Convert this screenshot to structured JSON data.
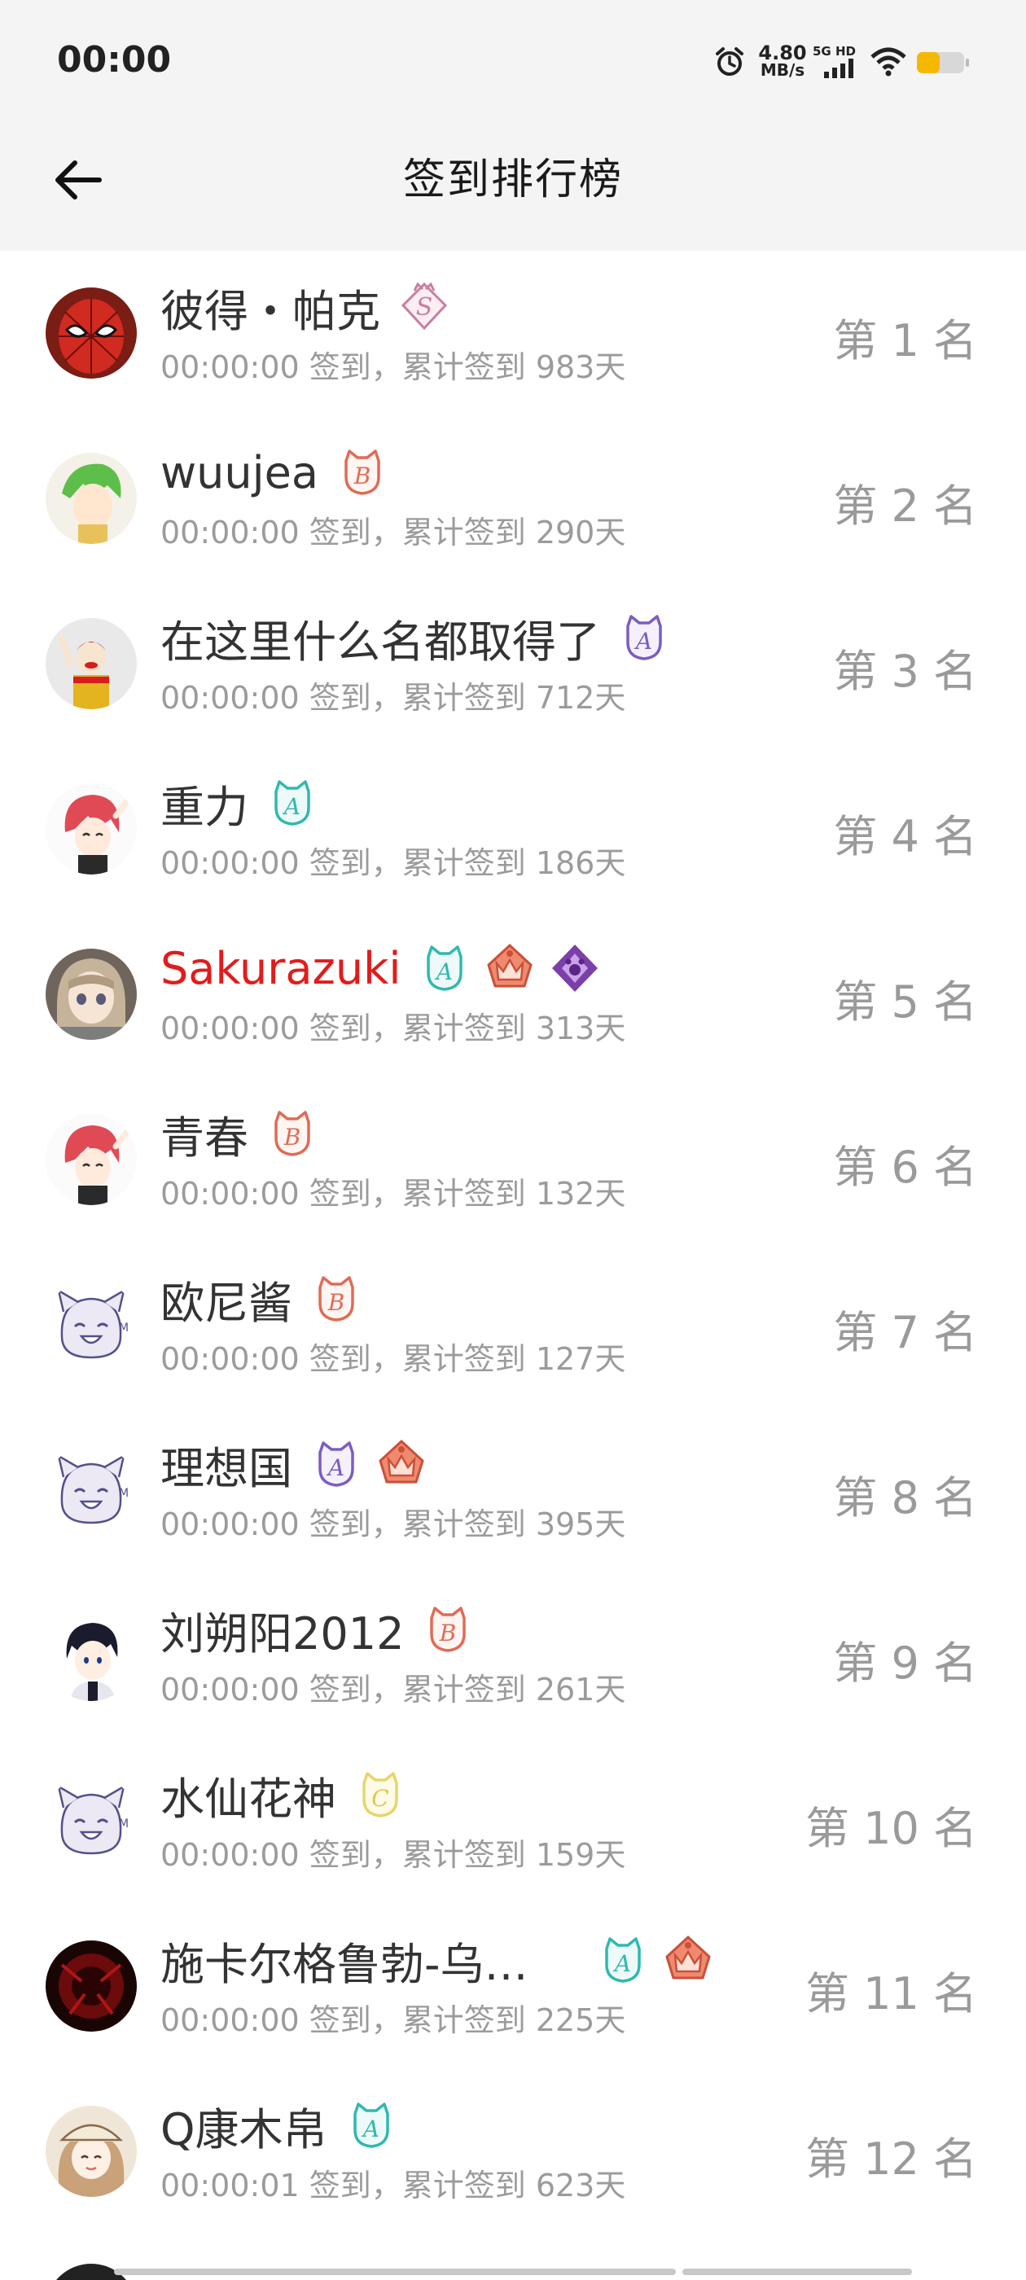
{
  "status_bar": {
    "time": "00:00",
    "net_speed_value": "4.80",
    "net_speed_unit": "MB/s",
    "signal_label": "5G HD",
    "icons": [
      "alarm-icon",
      "signal-icon",
      "wifi-icon",
      "battery-icon"
    ],
    "battery_color": "#f5b800"
  },
  "header": {
    "title": "签到排行榜",
    "back_icon": "arrow-left-icon"
  },
  "rows": [
    {
      "name": "彼得・帕克",
      "sub": "00:00:00 签到，累计签到 983天",
      "rank": "第 1 名",
      "badges": [
        "badge-s"
      ],
      "avatar": "spiderman-avatar"
    },
    {
      "name": "wuujea",
      "sub": "00:00:00 签到，累计签到 290天",
      "rank": "第 2 名",
      "badges": [
        "badge-b"
      ],
      "avatar": "anime-green-hair-avatar"
    },
    {
      "name": "在这里什么名都取得了",
      "sub": "00:00:00 签到，累计签到 712天",
      "rank": "第 3 名",
      "badges": [
        "badge-a-purple"
      ],
      "avatar": "clown-avatar"
    },
    {
      "name": "重力",
      "sub": "00:00:00 签到，累计签到 186天",
      "rank": "第 4 名",
      "badges": [
        "badge-a-teal"
      ],
      "avatar": "anime-red-hair-avatar"
    },
    {
      "name": "Sakurazuki",
      "sub": "00:00:00 签到，累计签到 313天",
      "rank": "第 5 名",
      "badges": [
        "badge-a-teal",
        "badge-crown",
        "badge-diamond"
      ],
      "avatar": "anime-girl-avatar",
      "highlight_color": "#e21b1b"
    },
    {
      "name": "青春",
      "sub": "00:00:00 签到，累计签到 132天",
      "rank": "第 6 名",
      "badges": [
        "badge-b"
      ],
      "avatar": "anime-red-hair-avatar"
    },
    {
      "name": "欧尼酱",
      "sub": "00:00:00 签到，累计签到 127天",
      "rank": "第 7 名",
      "badges": [
        "badge-b"
      ],
      "avatar": "default-cat-avatar"
    },
    {
      "name": "理想国",
      "sub": "00:00:00 签到，累计签到 395天",
      "rank": "第 8 名",
      "badges": [
        "badge-a-purple",
        "badge-crown"
      ],
      "avatar": "default-cat-avatar"
    },
    {
      "name": "刘朔阳2012",
      "sub": "00:00:00 签到，累计签到 261天",
      "rank": "第 9 名",
      "badges": [
        "badge-b"
      ],
      "avatar": "anime-boy-avatar"
    },
    {
      "name": "水仙花神",
      "sub": "00:00:00 签到，累计签到 159天",
      "rank": "第 10 名",
      "badges": [
        "badge-c"
      ],
      "avatar": "default-cat-avatar"
    },
    {
      "name": "施卡尔格鲁勃-乌…",
      "sub": "00:00:00 签到，累计签到 225天",
      "rank": "第 11 名",
      "badges": [
        "badge-a-teal",
        "badge-crown"
      ],
      "avatar": "dark-red-avatar"
    },
    {
      "name": "Q康木帛",
      "sub": "00:00:01 签到，累计签到 623天",
      "rank": "第 12 名",
      "badges": [
        "badge-a-teal"
      ],
      "avatar": "anime-hat-girl-avatar"
    }
  ]
}
